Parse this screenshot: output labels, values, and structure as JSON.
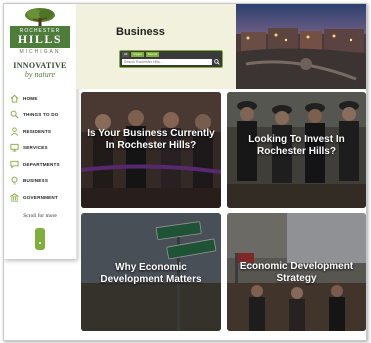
{
  "logo": {
    "top_text": "ROCHESTER",
    "main_text": "HILLS",
    "state_text": "MICHIGAN",
    "tagline_line1": "INNOVATIVE",
    "tagline_line2": "by nature"
  },
  "nav": {
    "items": [
      {
        "label": "HOME",
        "icon": "home-icon"
      },
      {
        "label": "THINGS TO DO",
        "icon": "search-icon"
      },
      {
        "label": "RESIDENTS",
        "icon": "person-icon"
      },
      {
        "label": "SERVICES",
        "icon": "monitor-icon"
      },
      {
        "label": "DEPARTMENTS",
        "icon": "chat-icon"
      },
      {
        "label": "BUSINESS",
        "icon": "lightbulb-icon"
      },
      {
        "label": "GOVERNMENT",
        "icon": "building-icon"
      }
    ]
  },
  "scroll": {
    "label": "Scroll for more"
  },
  "header": {
    "title": "Business",
    "search_placeholder": "Search Rochester Hills...",
    "search_tags": [
      "All",
      "Pages",
      "Events"
    ]
  },
  "tiles": [
    {
      "title": "Is Your Business Currently In Rochester Hills?"
    },
    {
      "title": "Looking To Invest In Rochester Hills?"
    },
    {
      "title": "Why Economic Development Matters"
    },
    {
      "title": "Economic Development Strategy"
    }
  ],
  "colors": {
    "accent": "#7fae3a",
    "logo_green": "#4e7d3b",
    "header_bg": "#f2f1dd"
  }
}
